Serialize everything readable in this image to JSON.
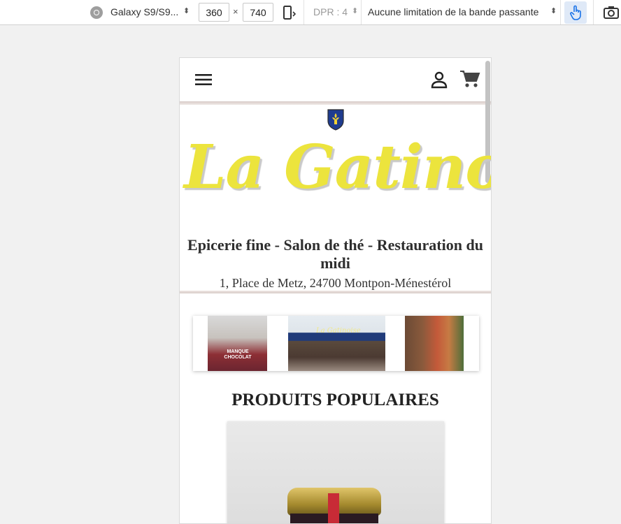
{
  "devtools": {
    "device": "Galaxy S9/S9...",
    "width": "360",
    "times": "×",
    "height": "740",
    "dpr": "DPR : 4",
    "throttling": "Aucune limitation de la bande passante"
  },
  "site": {
    "brand": "La Gatinoise",
    "tagline": "Epicerie fine - Salon de thé - Restauration du midi",
    "address": "1, Place de Metz, 24700 Montpon-Ménestérol",
    "carousel": {
      "slide1_text": "MANQUE CHOCOLAT",
      "slide2_text": "La Gatinoise"
    },
    "section_title": "PRODUITS POPULAIRES"
  },
  "colors": {
    "brand_yellow": "#ece43d",
    "touch_active": "#1a73e8"
  }
}
